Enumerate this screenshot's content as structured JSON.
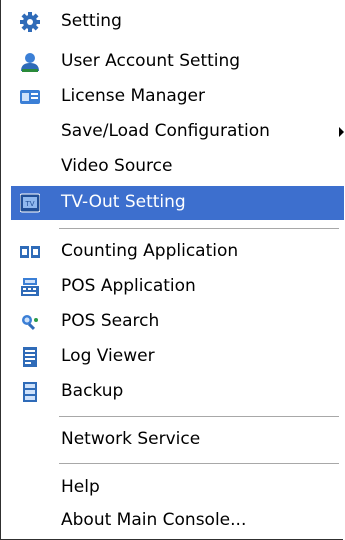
{
  "menu": {
    "items": [
      {
        "label": "Setting",
        "icon": "gear-icon"
      },
      {
        "label": "User Account Setting",
        "icon": "user-icon"
      },
      {
        "label": "License Manager",
        "icon": "license-card-icon"
      },
      {
        "label": "Save/Load Configuration",
        "icon": ""
      },
      {
        "label": "Video Source",
        "icon": ""
      },
      {
        "label": "TV-Out Setting",
        "icon": "tv-icon"
      },
      {
        "label": "Counting Application",
        "icon": "counter-icon"
      },
      {
        "label": "POS Application",
        "icon": "pos-register-icon"
      },
      {
        "label": "POS Search",
        "icon": "pos-search-icon"
      },
      {
        "label": "Log Viewer",
        "icon": "log-document-icon"
      },
      {
        "label": "Backup",
        "icon": "backup-icon"
      },
      {
        "label": "Network Service",
        "icon": ""
      },
      {
        "label": "Help",
        "icon": ""
      },
      {
        "label": "About Main Console...",
        "icon": ""
      }
    ],
    "selected_label": "TV-Out Setting"
  },
  "colors": {
    "selection": "#3d6fce",
    "icon_blue": "#2f6bb8",
    "separator": "#a8a8a8"
  }
}
